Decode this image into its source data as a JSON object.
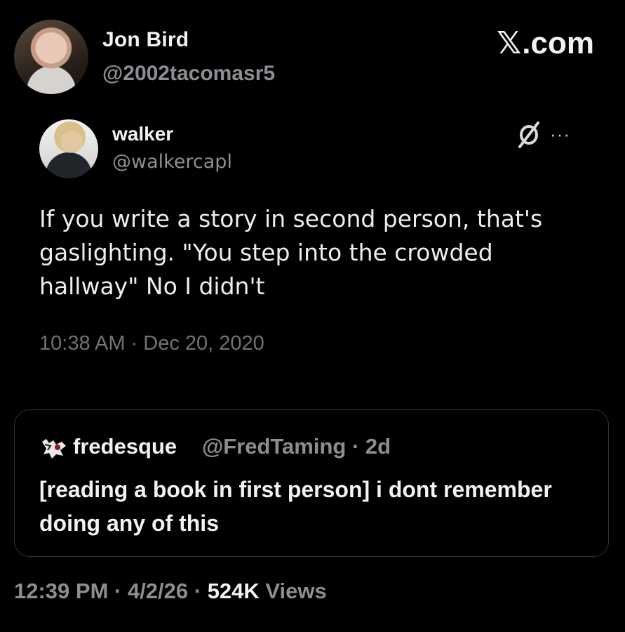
{
  "author": {
    "name": "Jon Bird",
    "handle": "@2002tacomasr5"
  },
  "brand": {
    "x_glyph": "𝕏",
    "suffix": ".com"
  },
  "quoted_tweet": {
    "name": "walker",
    "handle": "@walkercapl",
    "text": "If you write a story in second person, that's gaslighting. \"You step into the crowded hallway\" No I didn't",
    "timestamp": "10:38 AM · Dec 20, 2020",
    "more_label": "···"
  },
  "reply": {
    "name": "fredesque",
    "handle": "@FredTaming · 2d",
    "text": "[reading a book in first person]  i dont remember doing any of this"
  },
  "footer": {
    "time_date": "12:39 PM · 4/2/26 · ",
    "views_count": "524K",
    "views_label": " Views"
  }
}
